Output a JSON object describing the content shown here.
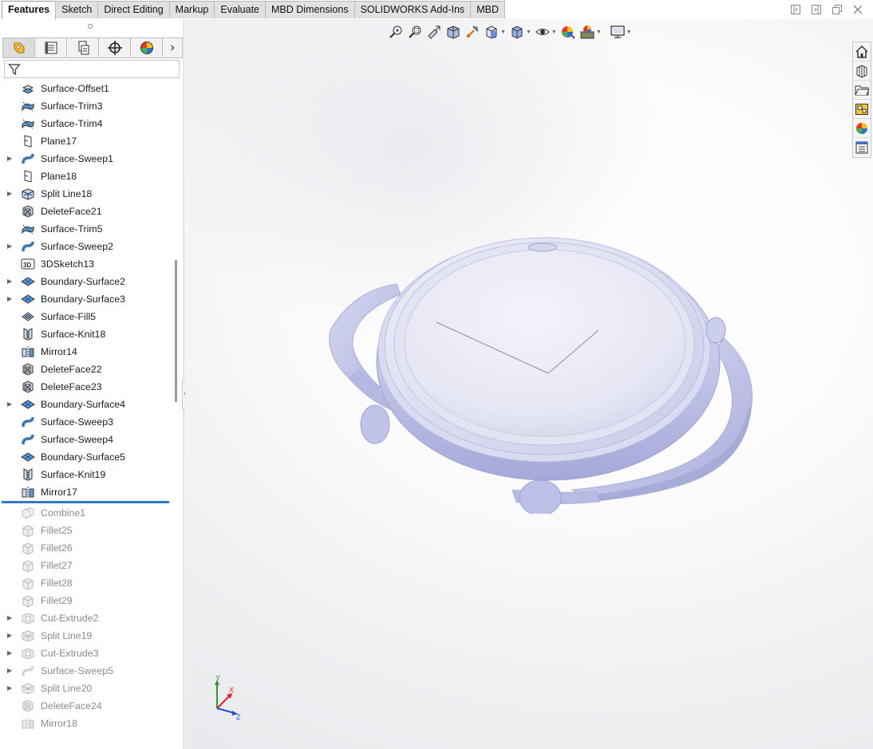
{
  "tabs": [
    {
      "label": "Features",
      "active": true
    },
    {
      "label": "Sketch",
      "active": false
    },
    {
      "label": "Direct Editing",
      "active": false
    },
    {
      "label": "Markup",
      "active": false
    },
    {
      "label": "Evaluate",
      "active": false
    },
    {
      "label": "MBD Dimensions",
      "active": false
    },
    {
      "label": "SOLIDWORKS Add-Ins",
      "active": false
    },
    {
      "label": "MBD",
      "active": false
    }
  ],
  "panel_tabs": [
    "feature-manager-icon",
    "property-manager-icon",
    "configuration-manager-icon",
    "dimxpert-manager-icon",
    "display-manager-icon"
  ],
  "panel_more": "›",
  "tree": {
    "active_items": [
      {
        "label": "Surface-Offset1",
        "icon": "surface-offset-icon",
        "expandable": false
      },
      {
        "label": "Surface-Trim3",
        "icon": "surface-trim-icon",
        "expandable": false
      },
      {
        "label": "Surface-Trim4",
        "icon": "surface-trim-icon",
        "expandable": false
      },
      {
        "label": "Plane17",
        "icon": "plane-icon",
        "expandable": false
      },
      {
        "label": "Surface-Sweep1",
        "icon": "surface-sweep-icon",
        "expandable": true
      },
      {
        "label": "Plane18",
        "icon": "plane-icon",
        "expandable": false
      },
      {
        "label": "Split Line18",
        "icon": "split-line-icon",
        "expandable": true
      },
      {
        "label": "DeleteFace21",
        "icon": "delete-face-icon",
        "expandable": false
      },
      {
        "label": "Surface-Trim5",
        "icon": "surface-trim-icon",
        "expandable": false
      },
      {
        "label": "Surface-Sweep2",
        "icon": "surface-sweep-icon",
        "expandable": true
      },
      {
        "label": "3DSketch13",
        "icon": "3d-sketch-icon",
        "expandable": false
      },
      {
        "label": "Boundary-Surface2",
        "icon": "boundary-surface-icon",
        "expandable": true
      },
      {
        "label": "Boundary-Surface3",
        "icon": "boundary-surface-icon",
        "expandable": true
      },
      {
        "label": "Surface-Fill5",
        "icon": "surface-fill-icon",
        "expandable": false
      },
      {
        "label": "Surface-Knit18",
        "icon": "surface-knit-icon",
        "expandable": false
      },
      {
        "label": "Mirror14",
        "icon": "mirror-icon",
        "expandable": false
      },
      {
        "label": "DeleteFace22",
        "icon": "delete-face-icon",
        "expandable": false
      },
      {
        "label": "DeleteFace23",
        "icon": "delete-face-icon",
        "expandable": false
      },
      {
        "label": "Boundary-Surface4",
        "icon": "boundary-surface-icon",
        "expandable": true
      },
      {
        "label": "Surface-Sweep3",
        "icon": "surface-sweep-icon",
        "expandable": false
      },
      {
        "label": "Surface-Sweep4",
        "icon": "surface-sweep-icon",
        "expandable": false
      },
      {
        "label": "Boundary-Surface5",
        "icon": "boundary-surface-icon",
        "expandable": false
      },
      {
        "label": "Surface-Knit19",
        "icon": "surface-knit-icon",
        "expandable": false
      },
      {
        "label": "Mirror17",
        "icon": "mirror-icon",
        "expandable": false
      }
    ],
    "suppressed_items": [
      {
        "label": "Combine1",
        "icon": "combine-icon",
        "expandable": false
      },
      {
        "label": "Fillet25",
        "icon": "fillet-icon",
        "expandable": false
      },
      {
        "label": "Fillet26",
        "icon": "fillet-icon",
        "expandable": false
      },
      {
        "label": "Fillet27",
        "icon": "fillet-icon",
        "expandable": false
      },
      {
        "label": "Fillet28",
        "icon": "fillet-icon",
        "expandable": false
      },
      {
        "label": "Fillet29",
        "icon": "fillet-icon",
        "expandable": false
      },
      {
        "label": "Cut-Extrude2",
        "icon": "cut-extrude-icon",
        "expandable": true
      },
      {
        "label": "Split Line19",
        "icon": "split-line-icon",
        "expandable": true
      },
      {
        "label": "Cut-Extrude3",
        "icon": "cut-extrude-icon",
        "expandable": true
      },
      {
        "label": "Surface-Sweep5",
        "icon": "surface-sweep-icon",
        "expandable": true
      },
      {
        "label": "Split Line20",
        "icon": "split-line-icon",
        "expandable": true
      },
      {
        "label": "DeleteFace24",
        "icon": "delete-face-icon",
        "expandable": false
      },
      {
        "label": "Mirror18",
        "icon": "mirror-icon",
        "expandable": false
      }
    ]
  },
  "heads_up_toolbar": [
    "zoom-to-fit-icon",
    "zoom-to-area-icon",
    "previous-view-icon",
    "section-view-icon",
    "dynamic-annotation-icon",
    "view-orientation-icon",
    "display-style-icon",
    "hide-show-items-icon",
    "edit-appearance-icon",
    "apply-scene-icon",
    "view-settings-icon"
  ],
  "task_pane": [
    "home-icon",
    "design-library-icon",
    "file-explorer-icon",
    "view-palette-icon",
    "appearances-icon",
    "custom-properties-icon"
  ],
  "triad": {
    "x": "X",
    "y": "Y",
    "z": "Z"
  },
  "colors": {
    "accent": "#2f7bc3",
    "model": "#c9cbe8",
    "suppressed_text": "#8a8a8a"
  }
}
